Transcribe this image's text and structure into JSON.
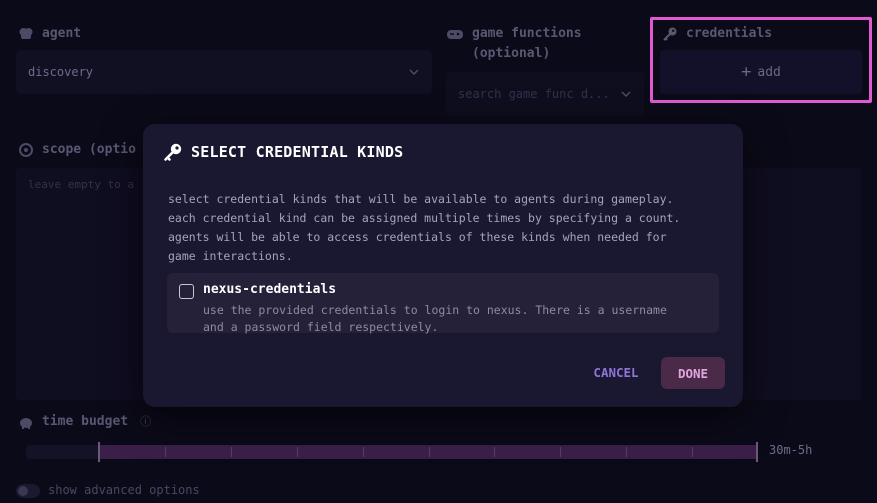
{
  "form": {
    "agent": {
      "label": "agent",
      "value": "discovery"
    },
    "game_functions": {
      "label": "game functions (optional)",
      "placeholder": "search game func d..."
    },
    "credentials": {
      "label": "credentials",
      "add_label": "add"
    },
    "scope": {
      "label": "scope (optio",
      "placeholder": "leave empty to a"
    },
    "time_budget": {
      "label": "time budget",
      "value": "30m-5h",
      "range_fraction": [
        0.1,
        1.0
      ]
    },
    "advanced": {
      "label": "show advanced options"
    }
  },
  "modal": {
    "title": "SELECT CREDENTIAL KINDS",
    "description": [
      "select credential kinds that will be available to agents during gameplay.",
      "each credential kind can be assigned multiple times by specifying a count.",
      "agents will be able to access credentials of these kinds when needed for",
      "game interactions."
    ],
    "items": [
      {
        "name": "nexus-credentials",
        "description": [
          "use the provided credentials to login to nexus. There is a username",
          "and a password field respectively."
        ]
      }
    ],
    "cancel_label": "CANCEL",
    "done_label": "DONE"
  },
  "colors": {
    "background": "#0b0a18",
    "modal": "#1a1730",
    "highlight": "#e25ad1",
    "cancel": "#8f74d8",
    "done_bg": "#4a2a48",
    "done_text": "#e0a6dd"
  }
}
